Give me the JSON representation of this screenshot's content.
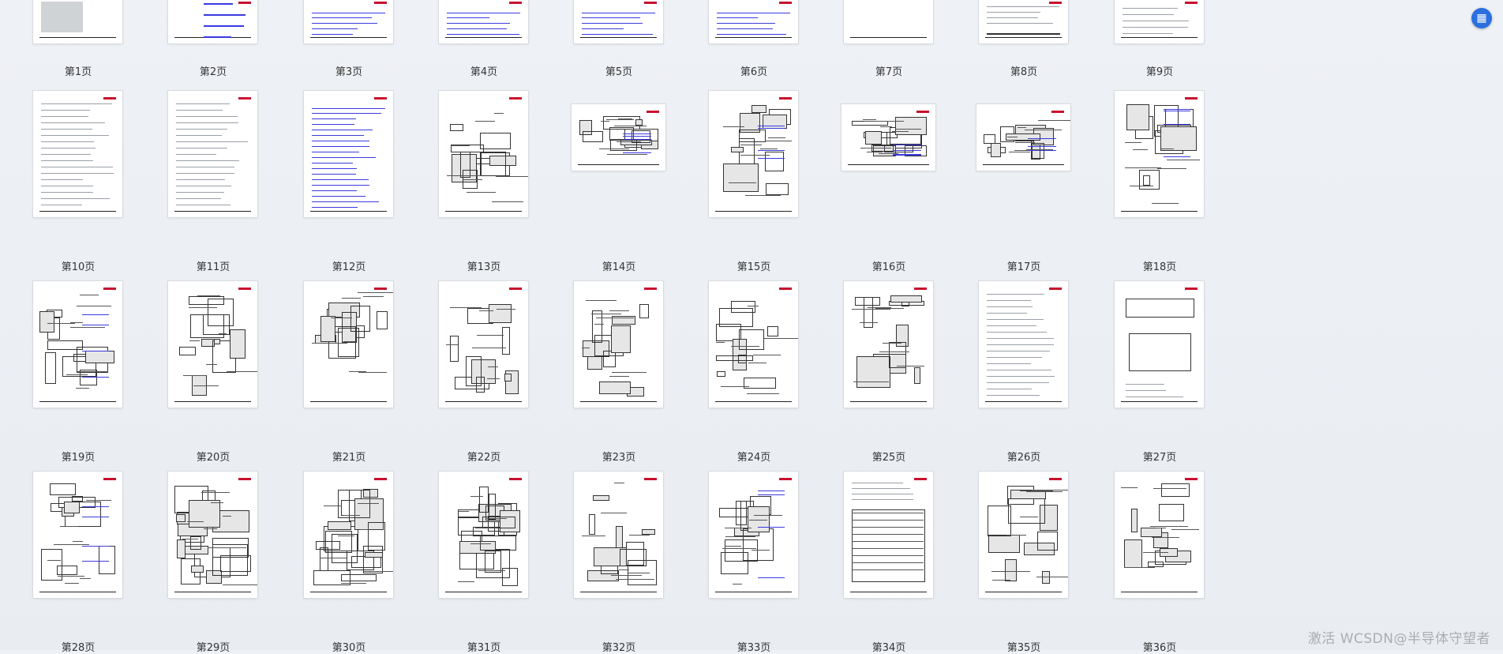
{
  "pages": [
    {
      "label": "第1页",
      "kind": "photo"
    },
    {
      "label": "第2页",
      "kind": "title"
    },
    {
      "label": "第3页",
      "kind": "toc"
    },
    {
      "label": "第4页",
      "kind": "toc"
    },
    {
      "label": "第5页",
      "kind": "toc"
    },
    {
      "label": "第6页",
      "kind": "toc"
    },
    {
      "label": "第7页",
      "kind": "blank"
    },
    {
      "label": "第8页",
      "kind": "table"
    },
    {
      "label": "第9页",
      "kind": "text"
    },
    {
      "label": "第10页",
      "kind": "text"
    },
    {
      "label": "第11页",
      "kind": "text"
    },
    {
      "label": "第12页",
      "kind": "toc"
    },
    {
      "label": "第13页",
      "kind": "drawing"
    },
    {
      "label": "第14页",
      "kind": "landscape"
    },
    {
      "label": "第15页",
      "kind": "diagram"
    },
    {
      "label": "第16页",
      "kind": "landscape"
    },
    {
      "label": "第17页",
      "kind": "landscape"
    },
    {
      "label": "第18页",
      "kind": "diagram"
    },
    {
      "label": "第19页",
      "kind": "diagram"
    },
    {
      "label": "第20页",
      "kind": "drawing"
    },
    {
      "label": "第21页",
      "kind": "drawing"
    },
    {
      "label": "第22页",
      "kind": "drawing"
    },
    {
      "label": "第23页",
      "kind": "drawing"
    },
    {
      "label": "第24页",
      "kind": "drawing"
    },
    {
      "label": "第25页",
      "kind": "drawing"
    },
    {
      "label": "第26页",
      "kind": "text"
    },
    {
      "label": "第27页",
      "kind": "form"
    },
    {
      "label": "第28页",
      "kind": "diagram"
    },
    {
      "label": "第29页",
      "kind": "circuit"
    },
    {
      "label": "第30页",
      "kind": "circuit"
    },
    {
      "label": "第31页",
      "kind": "circuit"
    },
    {
      "label": "第32页",
      "kind": "drawing"
    },
    {
      "label": "第33页",
      "kind": "diagram"
    },
    {
      "label": "第34页",
      "kind": "table"
    },
    {
      "label": "第35页",
      "kind": "drawing"
    },
    {
      "label": "第36页",
      "kind": "drawing"
    }
  ],
  "overlay": {
    "watermark": "激活 WCSDN@半导体守望者",
    "float_button_icon": "document-icon"
  }
}
